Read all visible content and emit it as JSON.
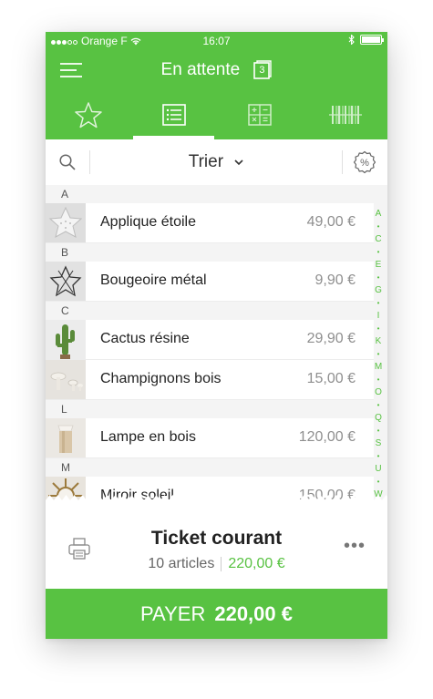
{
  "status_bar": {
    "carrier": "Orange F",
    "time": "16:07"
  },
  "header": {
    "title": "En attente",
    "badge": "3"
  },
  "tabs": [
    {
      "icon": "star-icon",
      "active": false
    },
    {
      "icon": "list-icon",
      "active": true
    },
    {
      "icon": "calculator-icon",
      "active": false
    },
    {
      "icon": "barcode-icon",
      "active": false
    }
  ],
  "toolbar": {
    "sort_label": "Trier"
  },
  "sections": {
    "a": "A",
    "b": "B",
    "c": "C",
    "l": "L",
    "m": "M"
  },
  "products": [
    {
      "name": "Applique étoile",
      "price": "49,00 €"
    },
    {
      "name": "Bougeoire métal",
      "price": "9,90 €"
    },
    {
      "name": "Cactus résine",
      "price": "29,90 €"
    },
    {
      "name": "Champignons bois",
      "price": "15,00 €"
    },
    {
      "name": "Lampe en bois",
      "price": "120,00 €"
    },
    {
      "name": "Miroir soleil",
      "price": "150,00 €"
    }
  ],
  "index_letters": [
    "A",
    "C",
    "E",
    "G",
    "I",
    "K",
    "M",
    "O",
    "Q",
    "S",
    "U",
    "W"
  ],
  "ticket": {
    "label": "Ticket courant",
    "articles": "10 articles",
    "amount": "220,00 €"
  },
  "pay": {
    "label": "PAYER",
    "amount": "220,00 €"
  },
  "colors": {
    "accent": "#58c242"
  }
}
